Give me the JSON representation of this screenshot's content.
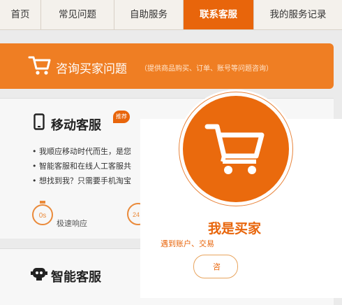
{
  "nav": {
    "tabs": [
      {
        "label": "首页"
      },
      {
        "label": "常见问题"
      },
      {
        "label": "自助服务"
      },
      {
        "label": "联系客服"
      },
      {
        "label": "我的服务记录"
      }
    ],
    "active_index": 3
  },
  "banner": {
    "title": "咨询买家问题",
    "subtitle": "（提供商品购买、订单、账号等问题咨询）",
    "icon": "cart-icon"
  },
  "mobile_service": {
    "title": "移动客服",
    "badge": "推荐",
    "icon": "phone-icon",
    "bullets": [
      "我顺应移动时代而生，是您",
      "智能客服和在线人工客服共",
      "想找到我？只需要手机淘宝"
    ],
    "feature_icon_text": "0s",
    "feature_label": "极速响应",
    "feature2_icon_text": "24"
  },
  "smart_service": {
    "title": "智能客服",
    "icon": "robot-icon"
  },
  "popup": {
    "title": "我是买家",
    "description": "遇到账户、交易",
    "button_label": "咨",
    "icon": "cart-icon"
  },
  "colors": {
    "accent": "#e8650b",
    "banner": "#ef7e23"
  }
}
